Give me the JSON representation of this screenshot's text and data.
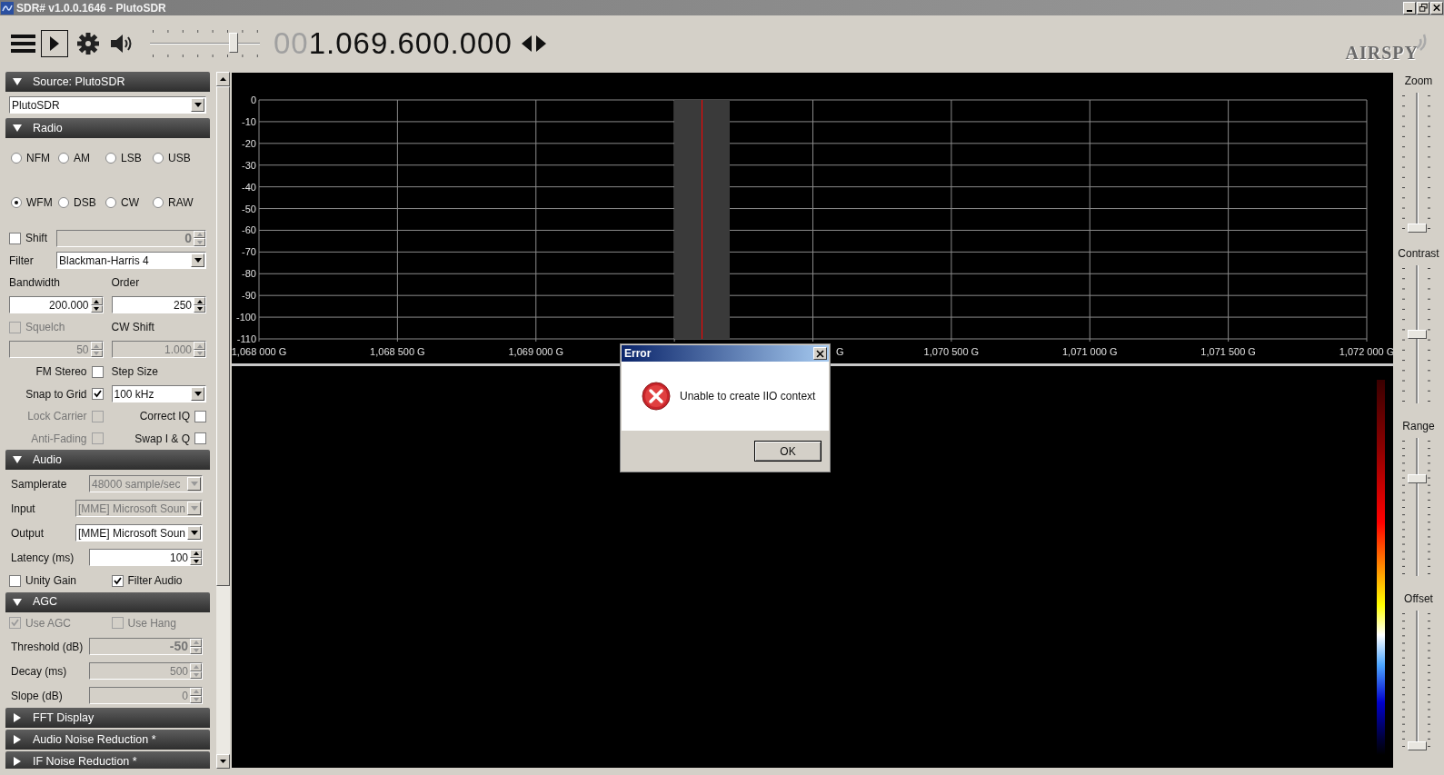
{
  "window": {
    "title": "SDR# v1.0.0.1646 - PlutoSDR"
  },
  "toolbar": {
    "volume": {
      "level": 0.77
    },
    "frequency": {
      "leading": "00",
      "digits": "1.069.600.000"
    }
  },
  "logo": "AIRSPY",
  "sidebar": {
    "sections": [
      {
        "title": "Source: PlutoSDR",
        "expanded": true,
        "rows": [
          {
            "kind": "full",
            "cells": [
              {
                "kind": "select",
                "value": "PlutoSDR",
                "disabled": false
              }
            ]
          }
        ]
      },
      {
        "title": "Radio",
        "expanded": true,
        "rows": [
          {
            "kind": "quarter",
            "cells": [
              {
                "kind": "radio",
                "label": "NFM",
                "selected": false
              },
              {
                "kind": "radio",
                "label": "AM",
                "selected": false
              },
              {
                "kind": "radio",
                "label": "LSB",
                "selected": false
              },
              {
                "kind": "radio",
                "label": "USB",
                "selected": false
              }
            ]
          },
          {
            "kind": "quarter",
            "cells": [
              {
                "kind": "radio",
                "label": "WFM",
                "selected": true
              },
              {
                "kind": "radio",
                "label": "DSB",
                "selected": false
              },
              {
                "kind": "radio",
                "label": "CW",
                "selected": false
              },
              {
                "kind": "radio",
                "label": "RAW",
                "selected": false
              }
            ]
          },
          {
            "kind": "narrow",
            "cells": [
              {
                "kind": "check",
                "label": "Shift",
                "checked": false,
                "disabled": false
              },
              {
                "kind": "spin",
                "value": "0",
                "disabled": true,
                "bold": true
              }
            ]
          },
          {
            "kind": "narrow",
            "cells": [
              {
                "kind": "text",
                "label": "Filter",
                "disabled": false
              },
              {
                "kind": "select",
                "value": "Blackman-Harris 4",
                "disabled": false
              }
            ]
          },
          {
            "kind": "half",
            "cells": [
              {
                "kind": "text",
                "label": "Bandwidth",
                "disabled": false
              },
              {
                "kind": "text",
                "label": "Order",
                "disabled": false
              }
            ]
          },
          {
            "kind": "half",
            "cells": [
              {
                "kind": "spin",
                "value": "200.000",
                "disabled": false
              },
              {
                "kind": "spin",
                "value": "250",
                "disabled": false
              }
            ]
          },
          {
            "kind": "half",
            "cells": [
              {
                "kind": "check",
                "label": "Squelch",
                "checked": false,
                "disabled": true
              },
              {
                "kind": "text",
                "label": "CW Shift",
                "disabled": false
              }
            ]
          },
          {
            "kind": "half",
            "cells": [
              {
                "kind": "spin",
                "value": "50",
                "disabled": true
              },
              {
                "kind": "spin",
                "value": "1.000",
                "disabled": true
              }
            ]
          },
          {
            "kind": "half",
            "cells": [
              {
                "kind": "check_after",
                "label": "FM Stereo",
                "checked": false,
                "disabled": false
              },
              {
                "kind": "text",
                "label": "Step Size",
                "disabled": false
              }
            ]
          },
          {
            "kind": "half",
            "cells": [
              {
                "kind": "check_after",
                "label": "Snap to Grid",
                "checked": true,
                "disabled": false
              },
              {
                "kind": "select",
                "value": "100 kHz",
                "disabled": false
              }
            ]
          },
          {
            "kind": "half",
            "cells": [
              {
                "kind": "check_after",
                "label": "Lock Carrier",
                "checked": false,
                "disabled": true
              },
              {
                "kind": "check_after",
                "label": "Correct IQ",
                "checked": false,
                "disabled": false
              }
            ]
          },
          {
            "kind": "half",
            "cells": [
              {
                "kind": "check_after",
                "label": "Anti-Fading",
                "checked": false,
                "disabled": true
              },
              {
                "kind": "check_after",
                "label": "Swap I & Q",
                "checked": false,
                "disabled": false
              }
            ]
          }
        ]
      },
      {
        "title": "Audio",
        "expanded": true,
        "rows": [
          {
            "kind": "wide",
            "cells": [
              {
                "kind": "text",
                "label": "Samplerate",
                "disabled": false
              },
              {
                "kind": "select",
                "value": "48000 sample/sec",
                "disabled": true
              }
            ]
          },
          {
            "kind": "wide",
            "cells": [
              {
                "kind": "text",
                "label": "Input",
                "disabled": false
              },
              {
                "kind": "select",
                "value": "[MME] Microsoft Soun",
                "disabled": true
              }
            ]
          },
          {
            "kind": "wide",
            "cells": [
              {
                "kind": "text",
                "label": "Output",
                "disabled": false
              },
              {
                "kind": "select",
                "value": "[MME] Microsoft Soun",
                "disabled": false
              }
            ]
          },
          {
            "kind": "wide",
            "cells": [
              {
                "kind": "text",
                "label": "Latency (ms)",
                "disabled": false
              },
              {
                "kind": "spin",
                "value": "100",
                "disabled": false
              }
            ]
          },
          {
            "kind": "half",
            "cells": [
              {
                "kind": "check",
                "label": "Unity Gain",
                "checked": false,
                "disabled": false
              },
              {
                "kind": "check",
                "label": "Filter Audio",
                "checked": true,
                "disabled": false
              }
            ]
          }
        ]
      },
      {
        "title": "AGC",
        "expanded": true,
        "rows": [
          {
            "kind": "half",
            "cells": [
              {
                "kind": "check",
                "label": "Use AGC",
                "checked": true,
                "disabled": true
              },
              {
                "kind": "check",
                "label": "Use Hang",
                "checked": false,
                "disabled": true
              }
            ]
          },
          {
            "kind": "wide",
            "cells": [
              {
                "kind": "text",
                "label": "Threshold (dB)",
                "disabled": false
              },
              {
                "kind": "spin",
                "value": "-50",
                "disabled": true,
                "bold": true
              }
            ]
          },
          {
            "kind": "wide",
            "cells": [
              {
                "kind": "text",
                "label": "Decay (ms)",
                "disabled": false
              },
              {
                "kind": "spin",
                "value": "500",
                "disabled": true
              }
            ]
          },
          {
            "kind": "wide",
            "cells": [
              {
                "kind": "text",
                "label": "Slope (dB)",
                "disabled": false
              },
              {
                "kind": "spin",
                "value": "0",
                "disabled": true
              }
            ]
          }
        ]
      },
      {
        "title": "FFT Display",
        "expanded": false
      },
      {
        "title": "Audio Noise Reduction *",
        "expanded": false
      },
      {
        "title": "IF Noise Reduction *",
        "expanded": false
      }
    ]
  },
  "spectrum": {
    "chart_data": {
      "type": "line",
      "ylim": [
        -110,
        0
      ],
      "yticks": [
        0,
        -10,
        -20,
        -30,
        -40,
        -50,
        -60,
        -70,
        -80,
        -90,
        -100,
        -110
      ],
      "categories": [
        "1,068 000 G",
        "1,068 500 G",
        "1,069 000 G",
        null,
        "G",
        "1,070 500 G",
        "1,071 000 G",
        "1,071 500 G",
        "1,072 000 G"
      ],
      "grid": true
    }
  },
  "side_sliders": [
    {
      "label": "Zoom",
      "level": 0
    },
    {
      "label": "Contrast",
      "level": 0.5
    },
    {
      "label": "Range",
      "level": 0.71
    },
    {
      "label": "Offset",
      "level": 0
    }
  ],
  "dialog": {
    "title": "Error",
    "message": "Unable to create IIO context",
    "buttons": [
      "OK"
    ]
  }
}
